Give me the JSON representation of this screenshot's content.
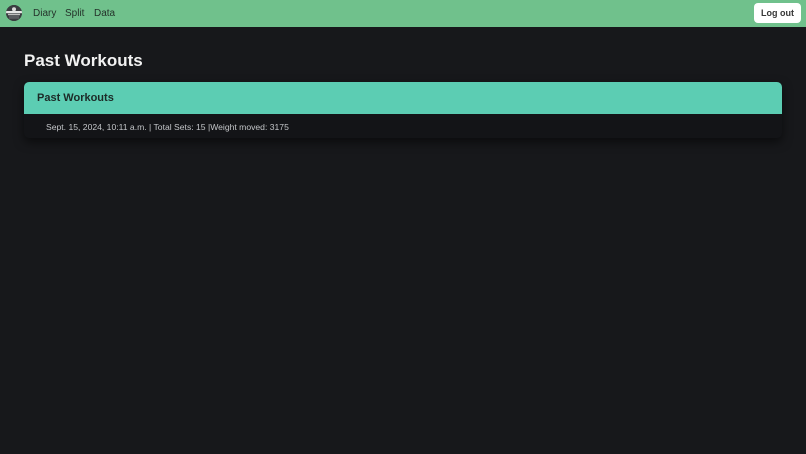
{
  "navbar": {
    "logo_icon": "logo-icon",
    "links": [
      "Diary",
      "Split",
      "Data"
    ],
    "logout_label": "Log out",
    "background": "#70c18c"
  },
  "main": {
    "title": "Past Workouts",
    "card": {
      "header": "Past Workouts",
      "header_color": "#5ccdb3",
      "entries": [
        "Sept. 15, 2024, 10:11 a.m. | Total Sets: 15 |Weight moved: 3175"
      ]
    }
  }
}
